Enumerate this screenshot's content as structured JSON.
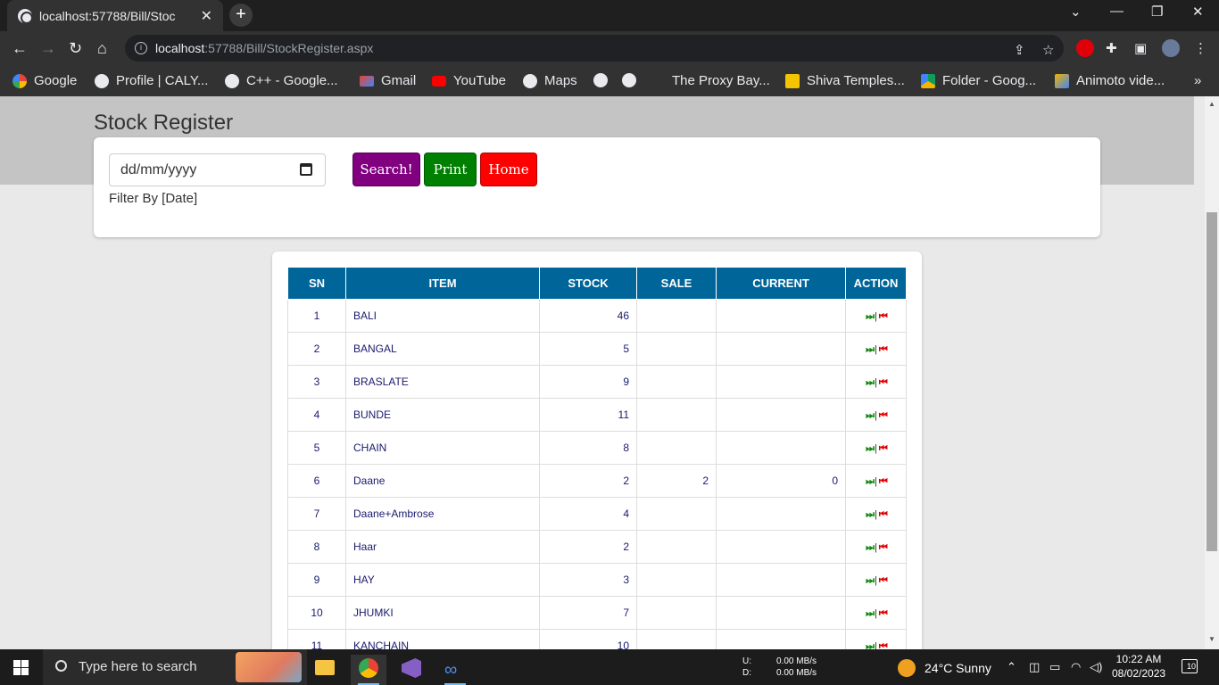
{
  "browser": {
    "tab_title": "localhost:57788/Bill/StockRegister.aspx",
    "tab_title_visible": "localhost:57788/Bill/Stoc",
    "url_host": "localhost",
    "url_path": ":57788/Bill/StockRegister.aspx"
  },
  "bookmarks": [
    {
      "label": "Google"
    },
    {
      "label": "Profile | CALY..."
    },
    {
      "label": "C++ - Google..."
    },
    {
      "label": "Gmail"
    },
    {
      "label": "YouTube"
    },
    {
      "label": "Maps"
    },
    {
      "label": ""
    },
    {
      "label": ""
    },
    {
      "label": "The Proxy Bay..."
    },
    {
      "label": "Shiva Temples..."
    },
    {
      "label": "Folder - Goog..."
    },
    {
      "label": "Animoto vide..."
    }
  ],
  "page": {
    "title": "Stock Register",
    "filter": {
      "date_placeholder": "dd/mm/yyyy",
      "label": "Filter By [Date]"
    },
    "buttons": {
      "search": "Search!",
      "print": "Print",
      "home": "Home"
    },
    "colors": {
      "search": "#800080",
      "print": "#008000",
      "home": "#ff0000",
      "header": "#006699"
    }
  },
  "table": {
    "columns": [
      "SN",
      "ITEM",
      "STOCK",
      "SALE",
      "CURRENT",
      "ACTION"
    ],
    "rows": [
      {
        "sn": "1",
        "item": "BALI",
        "stock": "46",
        "sale": "",
        "current": ""
      },
      {
        "sn": "2",
        "item": "BANGAL",
        "stock": "5",
        "sale": "",
        "current": ""
      },
      {
        "sn": "3",
        "item": "BRASLATE",
        "stock": "9",
        "sale": "",
        "current": ""
      },
      {
        "sn": "4",
        "item": "BUNDE",
        "stock": "11",
        "sale": "",
        "current": ""
      },
      {
        "sn": "5",
        "item": "CHAIN",
        "stock": "8",
        "sale": "",
        "current": ""
      },
      {
        "sn": "6",
        "item": "Daane",
        "stock": "2",
        "sale": "2",
        "current": "0"
      },
      {
        "sn": "7",
        "item": "Daane+Ambrose",
        "stock": "4",
        "sale": "",
        "current": ""
      },
      {
        "sn": "8",
        "item": "Haar",
        "stock": "2",
        "sale": "",
        "current": ""
      },
      {
        "sn": "9",
        "item": "HAY",
        "stock": "3",
        "sale": "",
        "current": ""
      },
      {
        "sn": "10",
        "item": "JHUMKI",
        "stock": "7",
        "sale": "",
        "current": ""
      },
      {
        "sn": "11",
        "item": "KANCHAIN",
        "stock": "10",
        "sale": "",
        "current": ""
      }
    ],
    "action": {
      "forward": "⏭",
      "separator": "|",
      "back": "⏮"
    }
  },
  "taskbar": {
    "search_placeholder": "Type here to search",
    "net_upload_label": "U:",
    "net_upload": "0.00 MB/s",
    "net_download_label": "D:",
    "net_download": "0.00 MB/s",
    "weather": "24°C  Sunny",
    "time": "10:22 AM",
    "date": "08/02/2023",
    "notifications": "10"
  }
}
